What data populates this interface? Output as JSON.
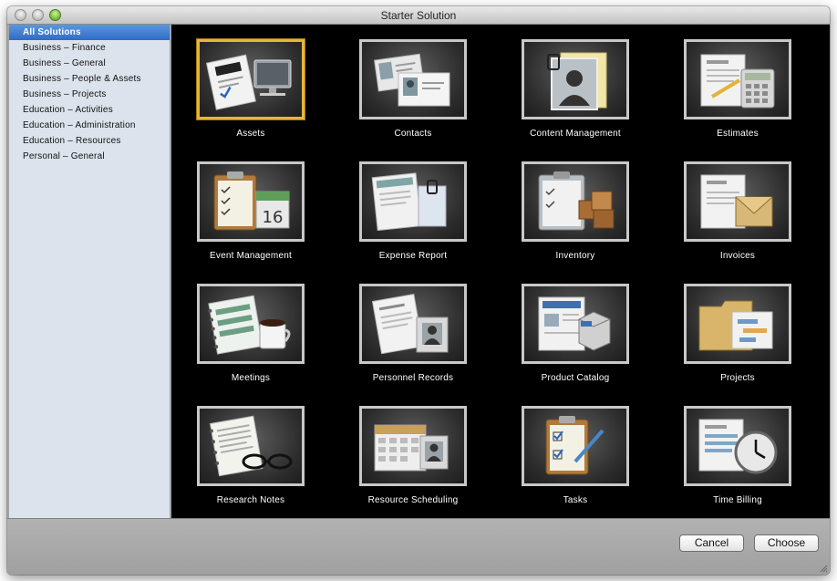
{
  "window": {
    "title": "Starter Solution"
  },
  "sidebar": {
    "items": [
      {
        "label": "All Solutions",
        "selected": true
      },
      {
        "label": "Business – Finance"
      },
      {
        "label": "Business – General"
      },
      {
        "label": "Business – People & Assets"
      },
      {
        "label": "Business – Projects"
      },
      {
        "label": "Education – Activities"
      },
      {
        "label": "Education – Administration"
      },
      {
        "label": "Education – Resources"
      },
      {
        "label": "Personal – General"
      }
    ]
  },
  "solutions": [
    {
      "label": "Assets",
      "icon": "asset-tag-monitor-icon",
      "selected": true
    },
    {
      "label": "Contacts",
      "icon": "contact-cards-icon"
    },
    {
      "label": "Content Management",
      "icon": "clipped-photo-document-icon"
    },
    {
      "label": "Estimates",
      "icon": "document-calculator-icon"
    },
    {
      "label": "Event Management",
      "icon": "clipboard-calendar-icon"
    },
    {
      "label": "Expense Report",
      "icon": "receipt-papers-icon"
    },
    {
      "label": "Inventory",
      "icon": "clipboard-boxes-icon"
    },
    {
      "label": "Invoices",
      "icon": "invoice-envelope-icon"
    },
    {
      "label": "Meetings",
      "icon": "notebook-coffee-icon"
    },
    {
      "label": "Personnel Records",
      "icon": "resume-badge-icon"
    },
    {
      "label": "Product Catalog",
      "icon": "catalog-box-icon"
    },
    {
      "label": "Projects",
      "icon": "folder-chart-icon"
    },
    {
      "label": "Research Notes",
      "icon": "notes-glasses-icon"
    },
    {
      "label": "Resource Scheduling",
      "icon": "calendar-badge-icon"
    },
    {
      "label": "Tasks",
      "icon": "clipboard-checklist-pen-icon"
    },
    {
      "label": "Time Billing",
      "icon": "timesheet-clock-icon"
    }
  ],
  "footer": {
    "cancel_label": "Cancel",
    "choose_label": "Choose"
  },
  "colors": {
    "selection_blue": "#3a78cc",
    "selected_tile_border": "#e6b53a",
    "grid_background": "#000000"
  }
}
